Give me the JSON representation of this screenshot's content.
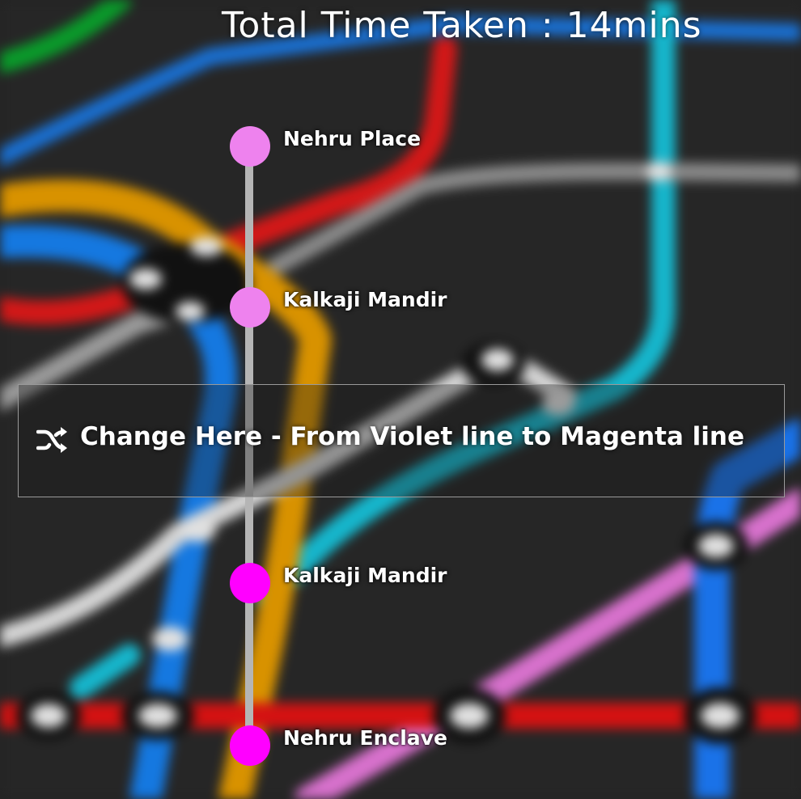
{
  "header": {
    "title": "Total Time Taken : 14mins"
  },
  "route": {
    "line_color": "#b5b5b5",
    "stations": [
      {
        "name": "Nehru Place",
        "line": "Violet",
        "color": "#ee82ee"
      },
      {
        "name": "Kalkaji Mandir",
        "line": "Violet",
        "color": "#ee82ee"
      },
      {
        "name": "Kalkaji Mandir",
        "line": "Magenta",
        "color": "#ff00ff"
      },
      {
        "name": "Nehru Enclave",
        "line": "Magenta",
        "color": "#ff00ff"
      }
    ]
  },
  "interchange": {
    "icon": "shuffle-icon",
    "text": "Change Here - From Violet line to Magenta line"
  }
}
